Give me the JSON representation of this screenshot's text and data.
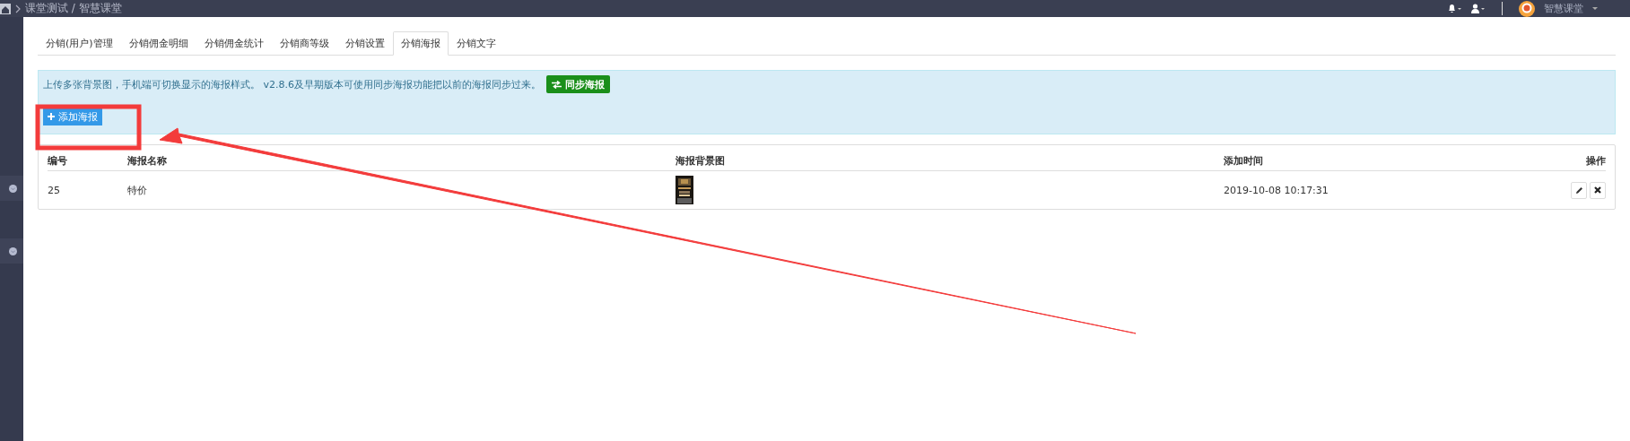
{
  "topbar": {
    "breadcrumb": "课堂测试 / 智慧课堂",
    "brand": "智慧课堂"
  },
  "tabs": [
    {
      "label": "分销(用户)管理",
      "selected": false
    },
    {
      "label": "分销佣金明细",
      "selected": false
    },
    {
      "label": "分销佣金统计",
      "selected": false
    },
    {
      "label": "分销商等级",
      "selected": false
    },
    {
      "label": "分销设置",
      "selected": false
    },
    {
      "label": "分销海报",
      "selected": true
    },
    {
      "label": "分销文字",
      "selected": false
    }
  ],
  "notice": {
    "text": "上传多张背景图，手机端可切换显示的海报样式。 v2.8.6及早期版本可使用同步海报功能把以前的海报同步过来。",
    "sync_button": "同步海报",
    "add_button": "添加海报"
  },
  "table": {
    "columns": [
      "编号",
      "海报名称",
      "海报背景图",
      "添加时间",
      "操作"
    ],
    "rows": [
      {
        "id": "25",
        "name": "特价",
        "time": "2019-10-08 10:17:31"
      }
    ]
  }
}
